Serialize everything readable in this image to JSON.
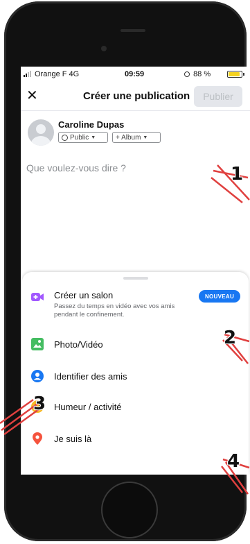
{
  "status_bar": {
    "carrier": "Orange F  4G",
    "time": "09:59",
    "battery": "88 %",
    "battery_level": 0.88,
    "battery_color": "#f4d21f"
  },
  "header": {
    "close_icon": "close-icon",
    "title": "Créer une publication",
    "publish_label": "Publier"
  },
  "author": {
    "name": "Caroline Dupas",
    "privacy_label": "Public",
    "album_label": "+ Album"
  },
  "composer": {
    "placeholder": "Que voulez-vous dire ?"
  },
  "sheet": {
    "items": [
      {
        "icon": "video-room-icon",
        "label": "Créer un salon",
        "sub": "Passez du temps en vidéo avec vos amis pendant le confinement.",
        "badge": "NOUVEAU",
        "color": "#a259ff"
      },
      {
        "icon": "photo-icon",
        "label": "Photo/Vidéo",
        "color": "#45bd62"
      },
      {
        "icon": "tag-friends-icon",
        "label": "Identifier des amis",
        "color": "#1877f2"
      },
      {
        "icon": "emoji-icon",
        "label": "Humeur / activité",
        "color": "#f7b928"
      },
      {
        "icon": "location-pin-icon",
        "label": "Je suis là",
        "color": "#f5533d"
      }
    ]
  },
  "annotations": [
    "1",
    "2",
    "3",
    "4"
  ],
  "accent_color": "#1877f2"
}
